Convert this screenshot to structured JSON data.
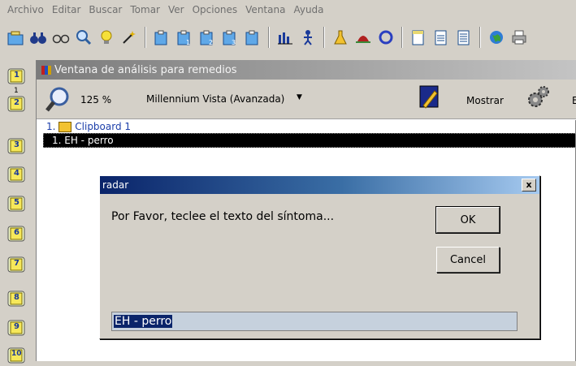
{
  "menubar": {
    "items": [
      "Archivo",
      "Editar",
      "Buscar",
      "Tomar",
      "Ver",
      "Opciones",
      "Ventana",
      "Ayuda"
    ]
  },
  "toolbar": {
    "icons": [
      "open-clipboard-icon",
      "binoculars-icon",
      "glasses-icon",
      "magnifier-icon",
      "lightbulb-icon",
      "wand-icon",
      "clipboard-add-icon",
      "clipboard-1-icon",
      "clipboard-2-icon",
      "clipboard-3-icon",
      "clipboard-4-icon",
      "bar-chart-icon",
      "person-icon",
      "flask-icon",
      "hat-icon",
      "circle-icon",
      "doc-1-icon",
      "doc-2-icon",
      "doc-3-icon",
      "globe-icon",
      "printer-icon"
    ]
  },
  "left_rail": {
    "buttons": [
      "1",
      "2",
      "3",
      "4",
      "5",
      "6",
      "7",
      "8",
      "9",
      "10"
    ],
    "extra_label": "1"
  },
  "analysis_window": {
    "title": "Ventana de análisis para remedios",
    "zoom": "125 %",
    "view_mode": "Millennium Vista (Avanzada)",
    "show_label": "Mostrar",
    "clipboard_row": "1. Clipboard 1",
    "selected_row": "1. EH - perro",
    "cut_label": "E"
  },
  "dialog": {
    "title": "radar",
    "close_label": "x",
    "prompt": "Por Favor, teclee el texto del síntoma...",
    "ok_label": "OK",
    "cancel_label": "Cancel",
    "input_value": "EH - perro"
  },
  "colors": {
    "dialog_title_start": "#0a246a",
    "dialog_title_end": "#a6caf0",
    "selection": "#0a246a",
    "window_title": "#9e9e9e"
  }
}
